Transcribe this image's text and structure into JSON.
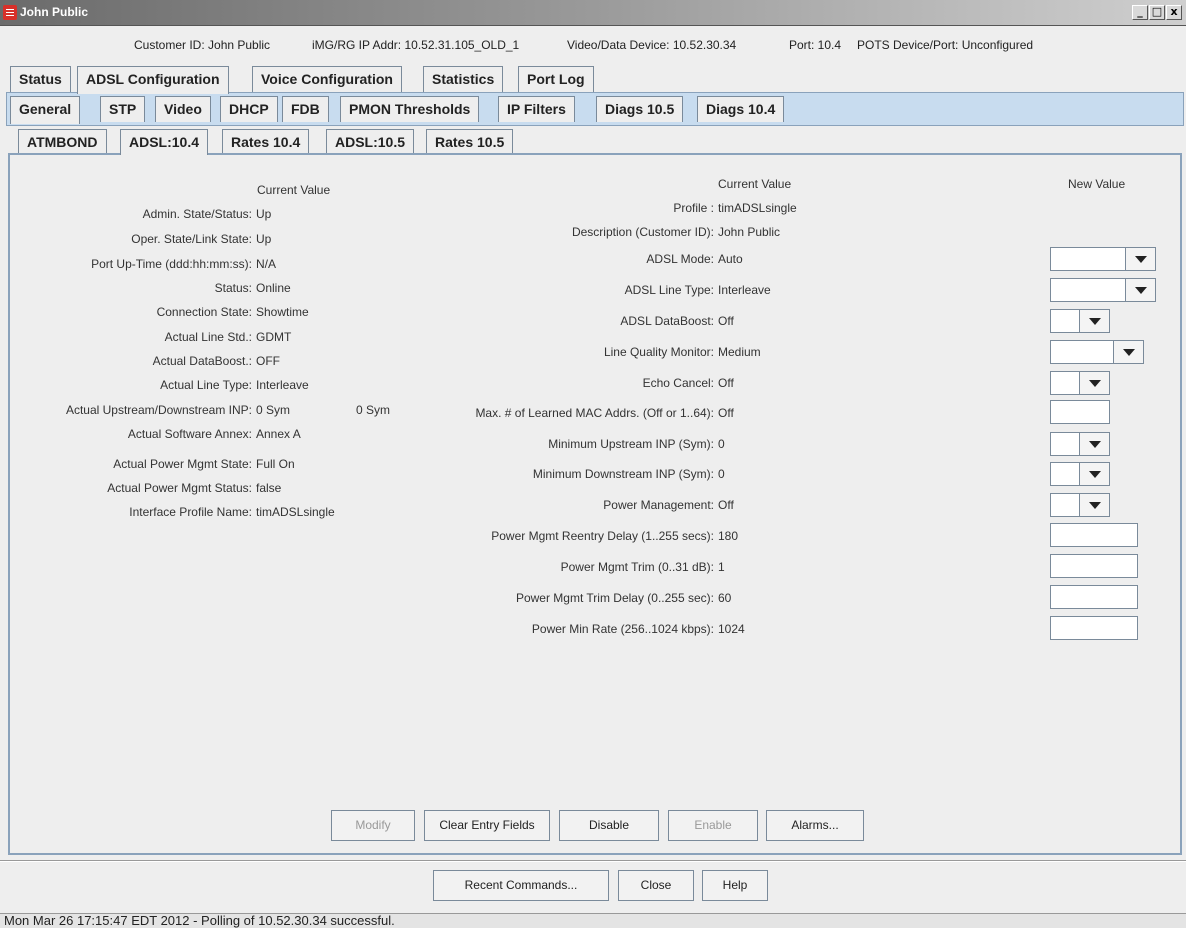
{
  "window": {
    "title": "John Public"
  },
  "info": {
    "customer_id": "Customer ID: John Public",
    "ip_addr": "iMG/RG IP Addr: 10.52.31.105_OLD_1",
    "video_data": "Video/Data Device: 10.52.30.34",
    "port": "Port: 10.4",
    "pots": "POTS Device/Port: Unconfigured"
  },
  "tabs_main": [
    "Status",
    "ADSL Configuration",
    "Voice Configuration",
    "Statistics",
    "Port Log"
  ],
  "tabs_sub": [
    "General",
    "STP",
    "Video",
    "DHCP",
    "FDB",
    "PMON Thresholds",
    "IP Filters",
    "Diags 10.5",
    "Diags 10.4"
  ],
  "tabs_inner": [
    "ATMBOND",
    "ADSL:10.4",
    "Rates 10.4",
    "ADSL:10.5",
    "Rates 10.5"
  ],
  "left": {
    "header": "Current Value",
    "rows": [
      {
        "label": "Admin. State/Status:",
        "value": "Up"
      },
      {
        "label": "Oper. State/Link State:",
        "value": "Up"
      },
      {
        "label": "Port Up-Time (ddd:hh:mm:ss):",
        "value": "N/A"
      },
      {
        "label": "Status:",
        "value": "Online"
      },
      {
        "label": "Connection State:",
        "value": "Showtime"
      },
      {
        "label": "Actual Line Std.:",
        "value": "GDMT"
      },
      {
        "label": "Actual DataBoost.:",
        "value": "OFF"
      },
      {
        "label": "Actual Line Type:",
        "value": "Interleave"
      },
      {
        "label": "Actual Upstream/Downstream INP:",
        "value": "0 Sym",
        "value2": "0 Sym"
      },
      {
        "label": "Actual Software Annex:",
        "value": "Annex A"
      },
      {
        "label": "Actual Power Mgmt State:",
        "value": "Full On"
      },
      {
        "label": "Actual Power Mgmt Status:",
        "value": "false"
      },
      {
        "label": "Interface Profile Name:",
        "value": "timADSLsingle"
      }
    ]
  },
  "right": {
    "header_current": "Current Value",
    "header_new": "New Value",
    "rows": [
      {
        "label": "Profile :",
        "value": "timADSLsingle"
      },
      {
        "label": "Description (Customer ID):",
        "value": "John Public"
      },
      {
        "label": "ADSL Mode:",
        "value": "Auto"
      },
      {
        "label": "ADSL Line Type:",
        "value": "Interleave"
      },
      {
        "label": "ADSL DataBoost:",
        "value": "Off"
      },
      {
        "label": "Line Quality Monitor:",
        "value": "Medium"
      },
      {
        "label": "Echo Cancel:",
        "value": "Off"
      },
      {
        "label": "Max. # of Learned MAC Addrs. (Off or 1..64):",
        "value": "Off"
      },
      {
        "label": "Minimum Upstream INP (Sym):",
        "value": "0"
      },
      {
        "label": "Minimum Downstream INP (Sym):",
        "value": "0"
      },
      {
        "label": "Power Management:",
        "value": "Off"
      },
      {
        "label": "Power Mgmt Reentry Delay (1..255 secs):",
        "value": "180"
      },
      {
        "label": "Power Mgmt Trim (0..31 dB):",
        "value": "1"
      },
      {
        "label": "Power Mgmt Trim Delay (0..255 sec):",
        "value": "60"
      },
      {
        "label": "Power Min Rate (256..1024 kbps):",
        "value": "1024"
      }
    ]
  },
  "panel_buttons": [
    "Modify",
    "Clear Entry Fields",
    "Disable",
    "Enable",
    "Alarms..."
  ],
  "bottom_buttons": [
    "Recent Commands...",
    "Close",
    "Help"
  ],
  "status": "Mon Mar 26 17:15:47 EDT 2012 - Polling of 10.52.30.34 successful."
}
